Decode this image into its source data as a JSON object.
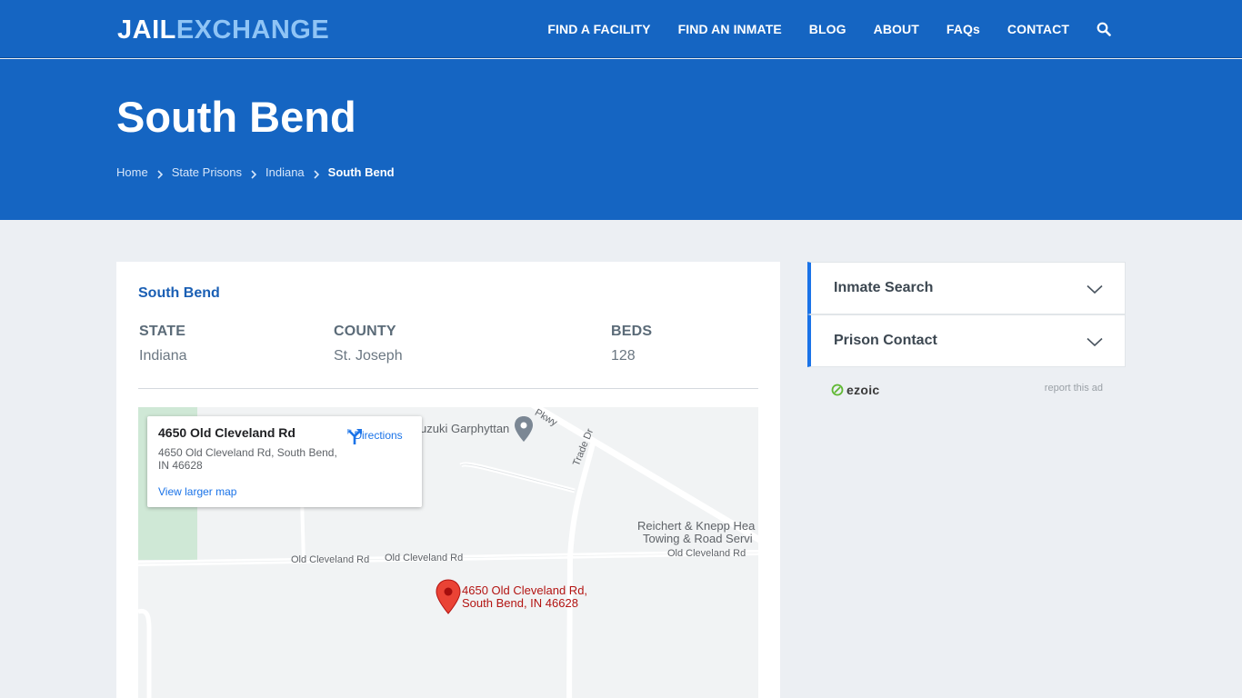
{
  "header": {
    "logo_part1": "JAIL",
    "logo_part2": "EXCHANGE",
    "nav": [
      "FIND A FACILITY",
      "FIND AN INMATE",
      "BLOG",
      "ABOUT",
      "FAQs",
      "CONTACT"
    ],
    "search_icon": "search-icon"
  },
  "hero": {
    "title": "South Bend",
    "breadcrumbs": [
      "Home",
      "State Prisons",
      "Indiana"
    ],
    "breadcrumb_current": "South Bend"
  },
  "facility": {
    "name": "South Bend",
    "state_label": "STATE",
    "state_value": "Indiana",
    "county_label": "COUNTY",
    "county_value": "St. Joseph",
    "beds_label": "BEDS",
    "beds_value": "128"
  },
  "map": {
    "infobox_title": "4650 Old Cleveland Rd",
    "infobox_address": "4650 Old Cleveland Rd, South Bend, IN 46628",
    "directions_label": "Directions",
    "larger_map_link": "View larger map",
    "pin_label_line1": "4650 Old Cleveland Rd,",
    "pin_label_line2": "South Bend, IN 46628",
    "road_labels": [
      "Old Cleveland Rd",
      "Old Cleveland Rd",
      "Old Cleveland Rd",
      "Trade Dr",
      "Pkwy"
    ],
    "poi_labels": [
      "uzuki Garphyttan",
      "Reichert & Knepp Hea",
      "Towing & Road Servi"
    ],
    "colors": {
      "land": "#f1f3f4",
      "park": "#cfe8d6",
      "pin": "#ea4335",
      "road": "#ffffff"
    }
  },
  "sidebar": {
    "items": [
      "Inmate Search",
      "Prison Contact"
    ]
  },
  "ad": {
    "brand": "ezoic",
    "report_label": "report this ad"
  },
  "colors": {
    "primary": "#1565c2",
    "accent": "#1a73e8",
    "page_bg": "#eceff3"
  }
}
